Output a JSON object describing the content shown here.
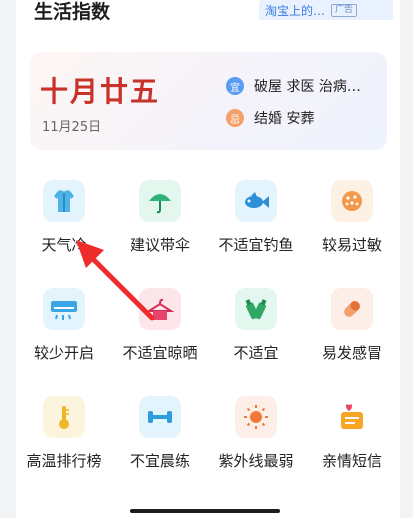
{
  "header": {
    "title": "生活指数"
  },
  "ad": {
    "text": "淘宝上的…",
    "tag": "广告"
  },
  "almanac": {
    "lunar_date": "十月廿五",
    "solar_date": "11月25日",
    "yi": {
      "badge": "宜",
      "text": "破屋 求医 治病…"
    },
    "ji": {
      "badge": "忌",
      "text": "结婚 安葬"
    }
  },
  "indices": [
    {
      "label": "天气冷",
      "icon": "clothing-icon"
    },
    {
      "label": "建议带伞",
      "icon": "umbrella-icon"
    },
    {
      "label": "不适宜钓鱼",
      "icon": "fish-icon"
    },
    {
      "label": "较易过敏",
      "icon": "pollen-icon"
    },
    {
      "label": "较少开启",
      "icon": "air-conditioner-icon"
    },
    {
      "label": "不适宜晾晒",
      "icon": "drying-rack-icon"
    },
    {
      "label": "不适宜",
      "icon": "bottles-icon"
    },
    {
      "label": "易发感冒",
      "icon": "pill-icon"
    },
    {
      "label": "高温排行榜",
      "icon": "thermometer-icon"
    },
    {
      "label": "不宜晨练",
      "icon": "dumbbell-icon"
    },
    {
      "label": "紫外线最弱",
      "icon": "sun-icon"
    },
    {
      "label": "亲情短信",
      "icon": "message-icon"
    }
  ],
  "colors": {
    "yi": "#5b9cf0",
    "ji": "#f4a06a",
    "lunar": "#c9312b"
  }
}
